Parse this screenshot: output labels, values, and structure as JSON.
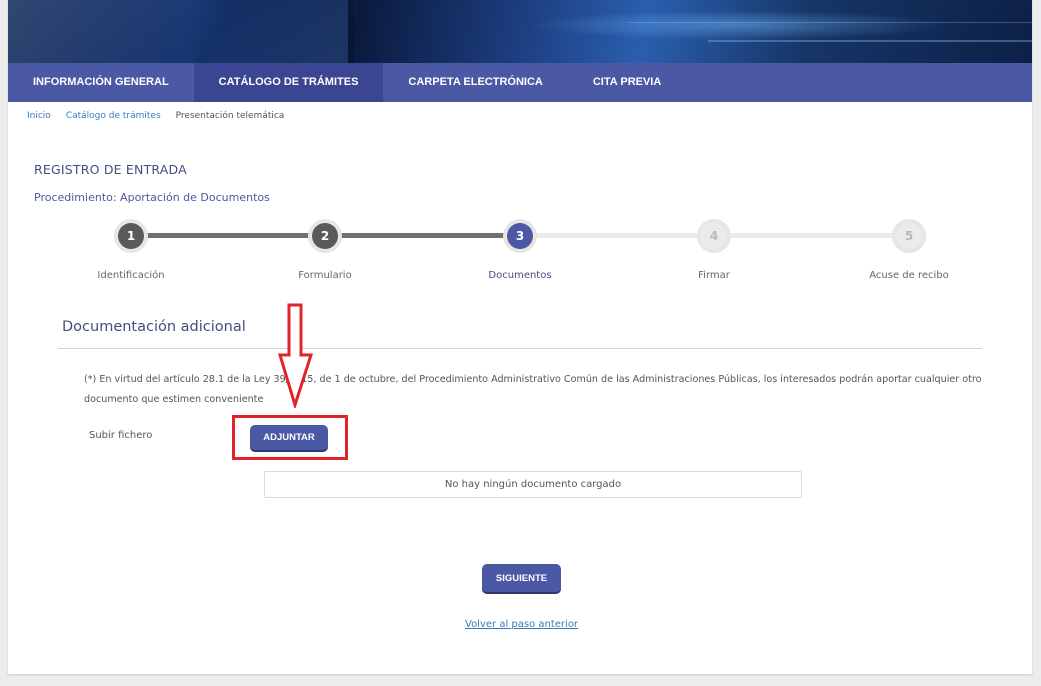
{
  "nav": {
    "items": [
      {
        "label": "INFORMACIÓN GENERAL"
      },
      {
        "label": "CATÁLOGO DE TRÁMITES"
      },
      {
        "label": "CARPETA ELECTRÓNICA"
      },
      {
        "label": "CITA PREVIA"
      }
    ],
    "active_index": 1
  },
  "breadcrumb": {
    "items": [
      {
        "label": "Inicio"
      },
      {
        "label": "Catálogo de trámites"
      },
      {
        "label": "Presentación telemática"
      }
    ]
  },
  "page": {
    "title": "REGISTRO DE ENTRADA",
    "procedure": "Procedimiento: Aportación de Documentos"
  },
  "stepper": {
    "steps": [
      {
        "number": "1",
        "label": "Identificación",
        "state": "done"
      },
      {
        "number": "2",
        "label": "Formulario",
        "state": "done"
      },
      {
        "number": "3",
        "label": "Documentos",
        "state": "current"
      },
      {
        "number": "4",
        "label": "Firmar",
        "state": "todo"
      },
      {
        "number": "5",
        "label": "Acuse de recibo",
        "state": "todo"
      }
    ]
  },
  "section": {
    "title": "Documentación adicional",
    "notice": "(*) En virtud del artículo 28.1 de la Ley 39/2015, de 1 de octubre, del Procedimiento Administrativo Común de las Administraciones Públicas, los interesados podrán aportar cualquier otro documento que estimen conveniente",
    "upload_label": "Subir fichero",
    "attach_button": "ADJUNTAR",
    "empty_message": "No hay ningún documento cargado"
  },
  "actions": {
    "next_button": "SIGUIENTE",
    "back_link": "Volver al paso anterior"
  },
  "colors": {
    "primary": "#4b58a3",
    "nav_active": "#3b4692",
    "highlight": "#e0242a",
    "link": "#3a7ab8"
  }
}
